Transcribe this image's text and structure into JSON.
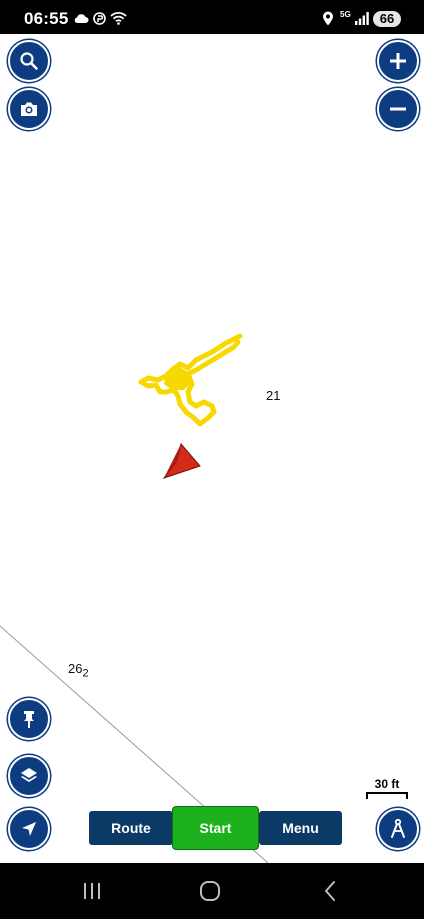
{
  "status_bar": {
    "time": "06:55",
    "network": "5G",
    "battery": "66",
    "left_icons": [
      "cloud-icon",
      "data-saver-icon",
      "wifi-icon"
    ],
    "right_icons": [
      "location-icon",
      "signal-icon"
    ]
  },
  "map": {
    "labels": {
      "depth_21": "21",
      "depth_26_main": "26",
      "depth_26_sub": "2"
    },
    "track_color": "#f7d800",
    "vessel_color": "#d42a1a",
    "scale_label": "30 ft"
  },
  "controls": {
    "left_top": [
      "search-icon",
      "camera-icon"
    ],
    "right_top": [
      "zoom-in-icon",
      "zoom-out-icon"
    ],
    "left_bottom": [
      "pin-icon",
      "layers-icon",
      "navigation-arrow-icon"
    ],
    "right_bottom": [
      "compass-icon"
    ],
    "button_color": "#0d3d80"
  },
  "bottom_bar": {
    "route_label": "Route",
    "start_label": "Start",
    "menu_label": "Menu",
    "start_color": "#1db11d"
  },
  "system_nav": [
    "recent-apps-icon",
    "home-icon",
    "back-icon"
  ]
}
